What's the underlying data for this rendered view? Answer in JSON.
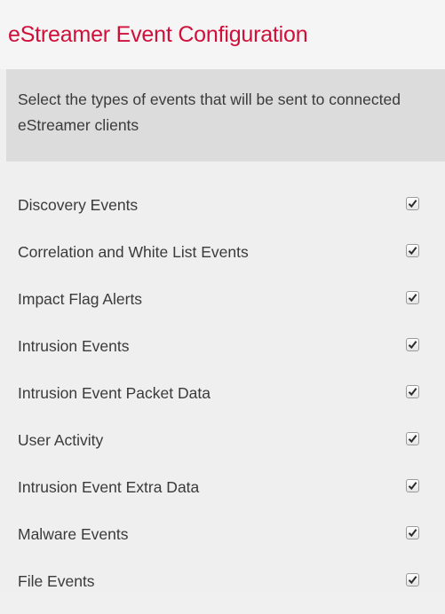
{
  "header": {
    "title": "eStreamer Event Configuration"
  },
  "description": "Select the types of events that will be sent to connected eStreamer clients",
  "colors": {
    "title": "#d0103a",
    "description_background": "#dcdcdc",
    "panel_background": "#efefef"
  },
  "events": [
    {
      "label": "Discovery Events",
      "checked": true
    },
    {
      "label": "Correlation and White List Events",
      "checked": true
    },
    {
      "label": "Impact Flag Alerts",
      "checked": true
    },
    {
      "label": "Intrusion Events",
      "checked": true
    },
    {
      "label": "Intrusion Event Packet Data",
      "checked": true
    },
    {
      "label": "User Activity",
      "checked": true
    },
    {
      "label": "Intrusion Event Extra Data",
      "checked": true
    },
    {
      "label": "Malware Events",
      "checked": true
    },
    {
      "label": "File Events",
      "checked": true
    }
  ]
}
